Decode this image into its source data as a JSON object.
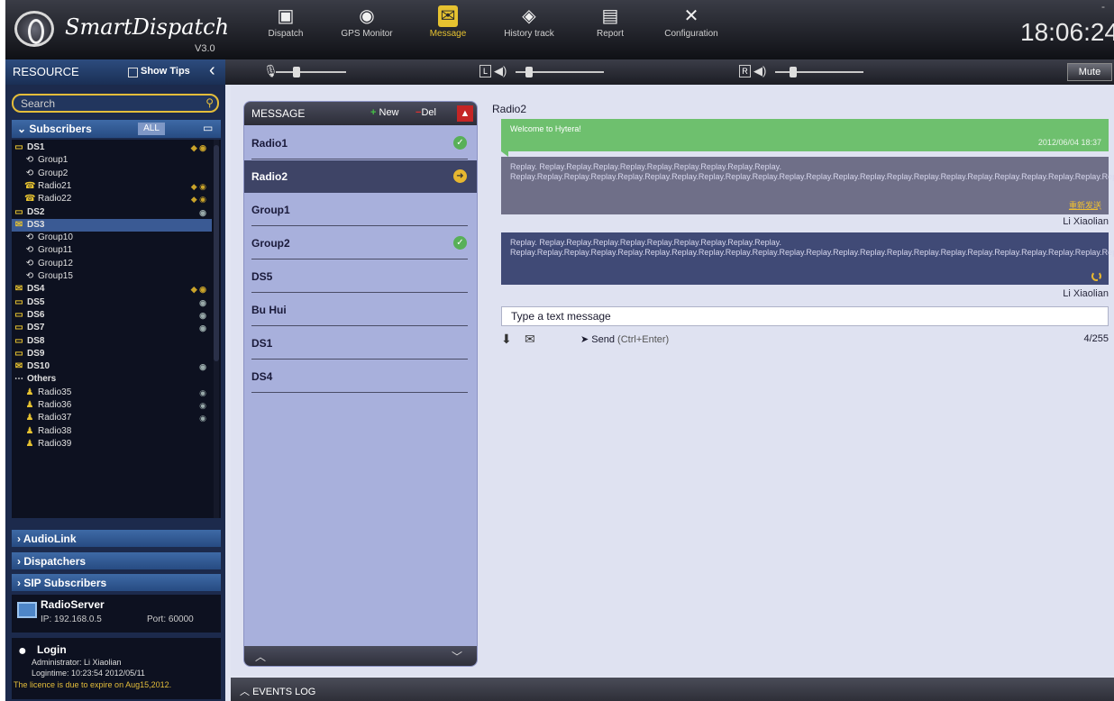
{
  "app": {
    "name": "SmartDispatch",
    "version": "V3.0",
    "clock": "18:06:24",
    "minimize": "-"
  },
  "nav": [
    {
      "label": "Dispatch",
      "icon": "dispatch-icon",
      "glyph": "▣"
    },
    {
      "label": "GPS Monitor",
      "icon": "globe-icon",
      "glyph": "◉"
    },
    {
      "label": "Message",
      "icon": "message-icon",
      "glyph": "✉"
    },
    {
      "label": "History track",
      "icon": "history-track-icon",
      "glyph": "◈"
    },
    {
      "label": "Report",
      "icon": "report-icon",
      "glyph": "▤"
    },
    {
      "label": "Configuration",
      "icon": "tools-icon",
      "glyph": "✕"
    }
  ],
  "active_nav": "Message",
  "audio": {
    "mute_label": "Mute",
    "left_label": "L",
    "right_label": "R",
    "mic_level": 0.3,
    "left_level": 0.15,
    "right_level": 0.2
  },
  "resource": {
    "title": "RESOURCE",
    "show_tips": "Show Tips"
  },
  "search": {
    "placeholder": "Search"
  },
  "subscribers": {
    "label": "Subscribers",
    "filter": "ALL",
    "items": [
      {
        "label": "DS1",
        "level": 0,
        "icon": "ds",
        "status": "◆ ◉"
      },
      {
        "label": "Group1",
        "level": 1,
        "icon": "group",
        "status": ""
      },
      {
        "label": "Group2",
        "level": 1,
        "icon": "group",
        "status": ""
      },
      {
        "label": "Radio21",
        "level": 1,
        "icon": "radio",
        "status": "◆ ◉"
      },
      {
        "label": "Radio22",
        "level": 1,
        "icon": "radio",
        "status": "◆ ◉"
      },
      {
        "label": "DS2",
        "level": 0,
        "icon": "ds",
        "status": "◉"
      },
      {
        "label": "DS3",
        "level": 0,
        "icon": "ds-alt",
        "status": "",
        "selected": true
      },
      {
        "label": "Group10",
        "level": 1,
        "icon": "group",
        "status": ""
      },
      {
        "label": "Group11",
        "level": 1,
        "icon": "group",
        "status": ""
      },
      {
        "label": "Group12",
        "level": 1,
        "icon": "group",
        "status": ""
      },
      {
        "label": "Group15",
        "level": 1,
        "icon": "group",
        "status": ""
      },
      {
        "label": "DS4",
        "level": 0,
        "icon": "ds-alt",
        "status": "◆ ◉"
      },
      {
        "label": "DS5",
        "level": 0,
        "icon": "ds",
        "status": "◉"
      },
      {
        "label": "DS6",
        "level": 0,
        "icon": "ds",
        "status": "◉"
      },
      {
        "label": "DS7",
        "level": 0,
        "icon": "ds",
        "status": "◉"
      },
      {
        "label": "DS8",
        "level": 0,
        "icon": "ds",
        "status": ""
      },
      {
        "label": "DS9",
        "level": 0,
        "icon": "ds",
        "status": ""
      },
      {
        "label": "DS10",
        "level": 0,
        "icon": "ds-alt",
        "status": "◉"
      },
      {
        "label": "Others",
        "level": 0,
        "icon": "others",
        "status": ""
      },
      {
        "label": "Radio35",
        "level": 1,
        "icon": "person",
        "status": "◉"
      },
      {
        "label": "Radio36",
        "level": 1,
        "icon": "person",
        "status": "◉"
      },
      {
        "label": "Radio37",
        "level": 1,
        "icon": "person",
        "status": "◉"
      },
      {
        "label": "Radio38",
        "level": 1,
        "icon": "person",
        "status": ""
      },
      {
        "label": "Radio39",
        "level": 1,
        "icon": "person",
        "status": ""
      }
    ]
  },
  "sections": [
    "AudioLink",
    "Dispatchers",
    "SIP Subscribers"
  ],
  "server": {
    "name": "RadioServer",
    "ip": "IP: 192.168.0.5",
    "port": "Port: 60000"
  },
  "login": {
    "title": "Login",
    "admin": "Administrator: Li Xiaolian",
    "time": "Logintime: 10:23:54 2012/05/11",
    "licence": "The licence is due to expire on Aug15,2012."
  },
  "message_panel": {
    "title": "MESSAGE",
    "new_label": "New",
    "del_label": "Del",
    "items": [
      {
        "label": "Radio1",
        "badge": "check"
      },
      {
        "label": "Radio2",
        "badge": "arrow",
        "selected": true
      },
      {
        "label": "Group1",
        "badge": ""
      },
      {
        "label": "Group2",
        "badge": "check"
      },
      {
        "label": "DS5",
        "badge": ""
      },
      {
        "label": "Bu Hui",
        "badge": ""
      },
      {
        "label": "DS1",
        "badge": ""
      },
      {
        "label": "DS4",
        "badge": ""
      }
    ]
  },
  "chat": {
    "title": "Radio2",
    "messages": [
      {
        "kind": "incoming",
        "text": "Welcome to Hytera!",
        "time": "2012/06/04 18:37"
      },
      {
        "kind": "failed",
        "text": "Replay. Replay.Replay.Replay.Replay.Replay.Replay.Replay.Replay.Replay. Replay.Replay.Replay.Replay.Replay.Replay.Replay.Replay.Replay.Replay.Replay.Replay.Replay.Replay.Replay.Replay.Replay.Replay.Replay.Replay.Replay.Replay.Replay.Replay.Replay.Replay.Replay.Replay.Replay.Replay.Replay.Replay.",
        "resend": "重新发送",
        "sender": "Li Xiaolian"
      },
      {
        "kind": "sending",
        "text": "Replay. Replay.Replay.Replay.Replay.Replay.Replay.Replay.Replay.Replay. Replay.Replay.Replay.Replay.Replay.Replay.Replay.Replay.Replay.Replay.Replay.Replay.Replay.Replay.Replay.Replay.Replay.Replay.Replay.Replay.Replay.Replay.Replay.Replay.Replay.Replay.Replay.Replay.Replay.Replay.Replay.Replay.",
        "sender": "Li Xiaolian"
      }
    ],
    "input_placeholder": "Type a text message",
    "send_label": "Send",
    "send_hint": "(Ctrl+Enter)",
    "char_count": "4/255"
  },
  "events_log": "EVENTS LOG",
  "colors": {
    "accent": "#e6c230",
    "online": "#58b058",
    "panel": "#a8b0dc"
  }
}
